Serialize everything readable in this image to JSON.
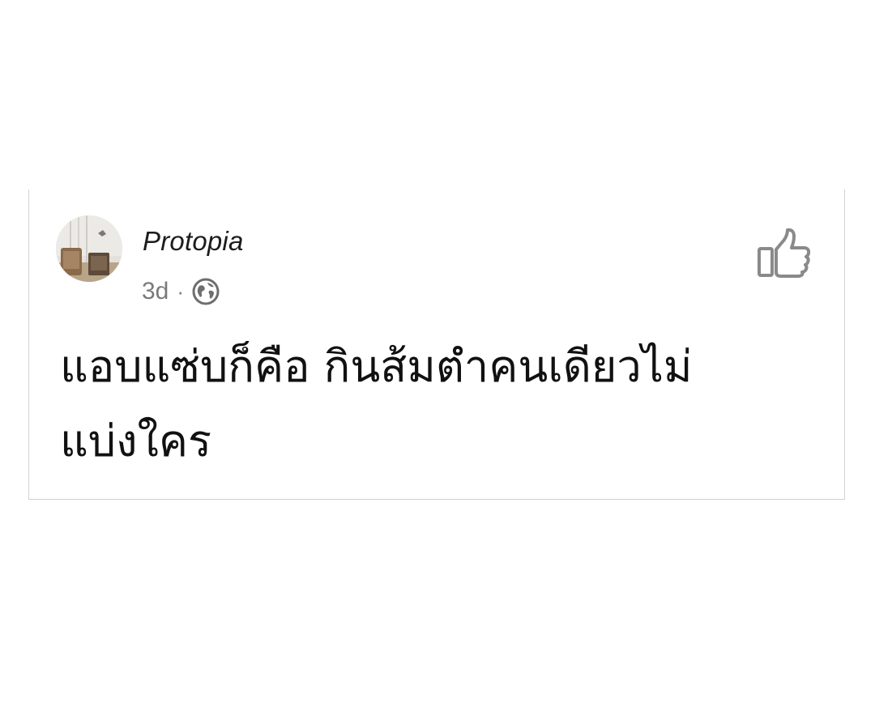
{
  "post": {
    "author_name": "Protopia",
    "timestamp": "3d",
    "separator": "·",
    "privacy_icon": "globe-icon",
    "like_icon": "thumbs-up-icon",
    "text_line_1": "แอบแซ่บก็คือ กินส้มตำคนเดียวไม่",
    "text_line_2": "แบ่งใคร"
  },
  "colors": {
    "background": "#ffffff",
    "text": "#111111",
    "meta_text": "#7a7a7a",
    "icon": "#8a8a8a",
    "border": "#d3d3d3"
  }
}
